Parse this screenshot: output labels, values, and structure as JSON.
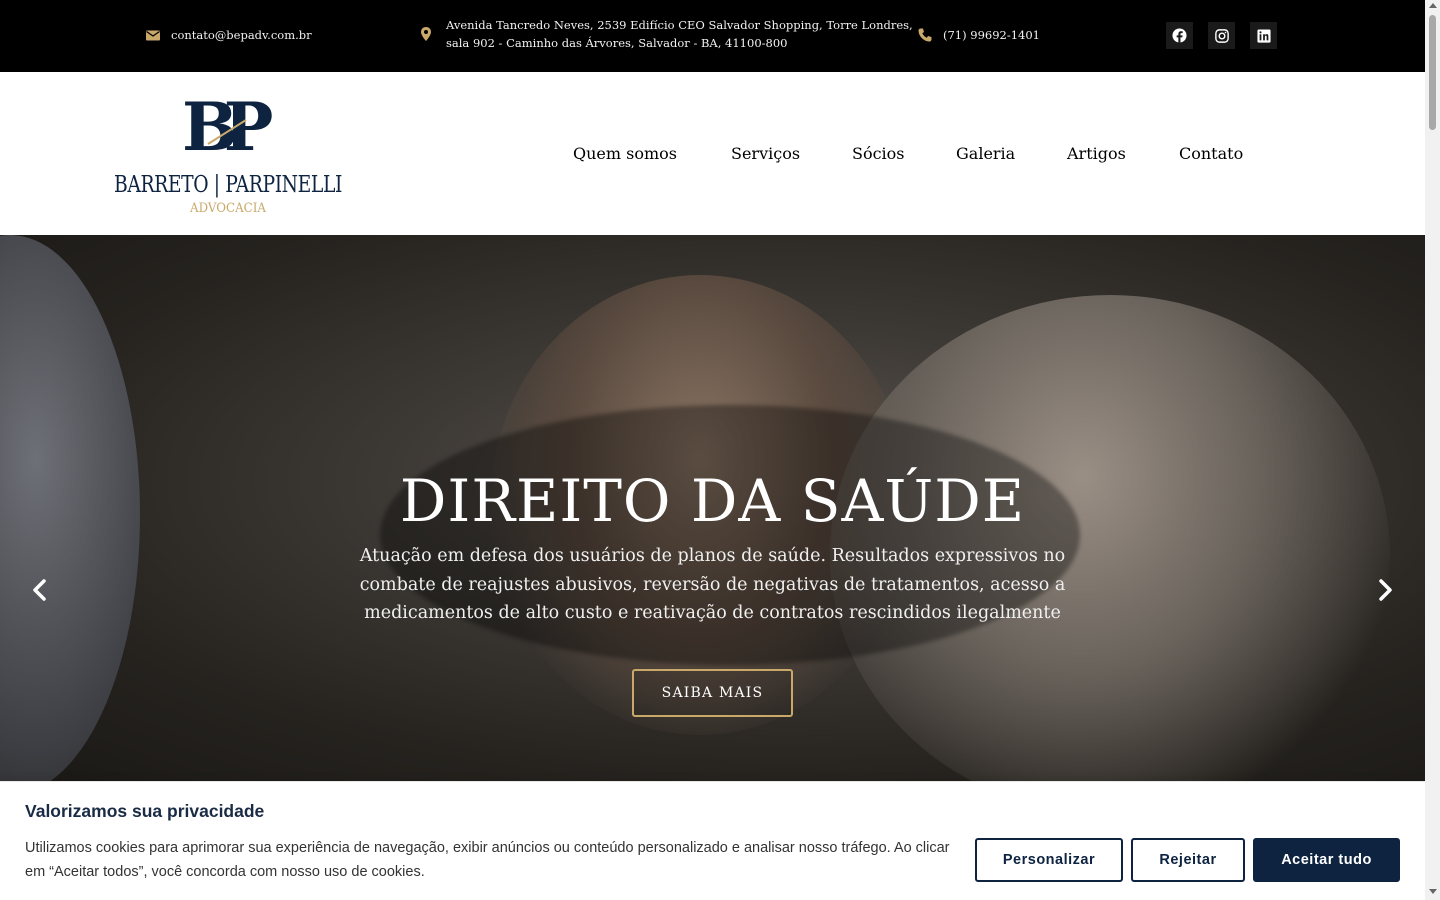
{
  "topbar": {
    "email": "contato@bepadv.com.br",
    "address_line1": "Avenida Tancredo Neves, 2539 Edifício CEO Salvador Shopping, Torre Londres,",
    "address_line2": "sala 902 - Caminho das Árvores, Salvador - BA, 41100-800",
    "phone": "(71) 99692-1401",
    "social_icons": [
      "facebook-icon",
      "instagram-icon",
      "linkedin-icon"
    ]
  },
  "logo": {
    "monogram": "BP",
    "name": "BARRETO | PARPINELLI",
    "tagline": "ADVOCACIA"
  },
  "nav": {
    "items": [
      "Quem somos",
      "Serviços",
      "Sócios",
      "Galeria",
      "Artigos",
      "Contato"
    ]
  },
  "hero": {
    "title": "DIREITO DA SAÚDE",
    "subtitle": "Atuação em defesa dos usuários de planos de saúde. Resultados expressivos no combate de reajustes abusivos, reversão de negativas de tratamentos, acesso a medicamentos de alto custo e reativação de contratos rescindidos ilegalmente",
    "button": "SAIBA MAIS"
  },
  "cookie": {
    "title": "Valorizamos sua privacidade",
    "text": "Utilizamos cookies para aprimorar sua experiência de navegação, exibir anúncios ou conteúdo personalizado e analisar nosso tráfego. Ao clicar em “Aceitar todos”, você concorda com nosso uso de cookies.",
    "btn_customize": "Personalizar",
    "btn_reject": "Rejeitar",
    "btn_accept": "Aceitar tudo"
  },
  "colors": {
    "navy": "#0d2340",
    "gold": "#c8a96a",
    "topbar_bg": "#000000"
  }
}
